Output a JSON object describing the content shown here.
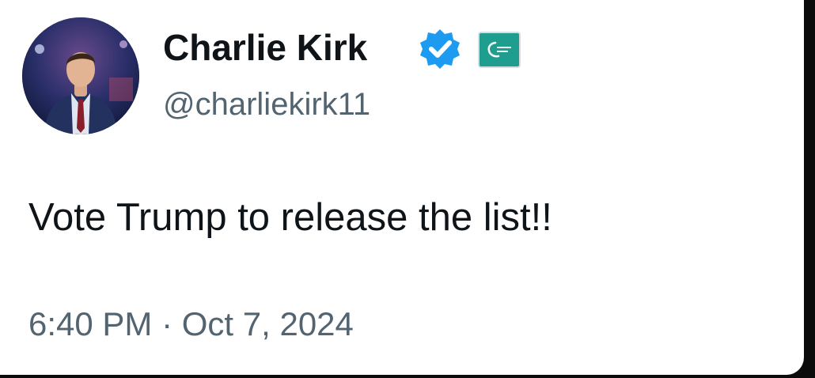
{
  "tweet": {
    "author": {
      "display_name": "Charlie Kirk",
      "handle": "@charliekirk11",
      "verified": true,
      "verified_color": "#1d9bf0",
      "affiliate_badge_color": "#1f9e8f"
    },
    "text": "Vote Trump to release the list!!",
    "time": "6:40 PM",
    "separator": "·",
    "date": "Oct 7, 2024"
  }
}
